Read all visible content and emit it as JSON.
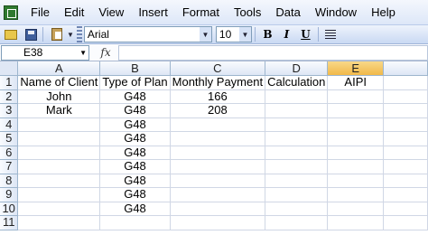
{
  "menu": {
    "items": [
      {
        "label": "File"
      },
      {
        "label": "Edit"
      },
      {
        "label": "View"
      },
      {
        "label": "Insert"
      },
      {
        "label": "Format"
      },
      {
        "label": "Tools"
      },
      {
        "label": "Data"
      },
      {
        "label": "Window"
      },
      {
        "label": "Help"
      }
    ]
  },
  "toolbar": {
    "font_name": "Arial",
    "font_size": "10",
    "bold_label": "B",
    "italic_label": "I",
    "underline_label": "U"
  },
  "formula_bar": {
    "name_box": "E38",
    "fx_label": "fx",
    "value": ""
  },
  "sheet": {
    "columns": [
      "A",
      "B",
      "C",
      "D",
      "E"
    ],
    "selected_column": "E",
    "rows": [
      {
        "num": "1",
        "cells": [
          "Name of Client",
          "Type of Plan",
          "Monthly Payment",
          "Calculation",
          "AIPI"
        ]
      },
      {
        "num": "2",
        "cells": [
          "John",
          "G48",
          "166",
          "",
          ""
        ]
      },
      {
        "num": "3",
        "cells": [
          "Mark",
          "G48",
          "208",
          "",
          ""
        ]
      },
      {
        "num": "4",
        "cells": [
          "",
          "G48",
          "",
          "",
          ""
        ]
      },
      {
        "num": "5",
        "cells": [
          "",
          "G48",
          "",
          "",
          ""
        ]
      },
      {
        "num": "6",
        "cells": [
          "",
          "G48",
          "",
          "",
          ""
        ]
      },
      {
        "num": "7",
        "cells": [
          "",
          "G48",
          "",
          "",
          ""
        ]
      },
      {
        "num": "8",
        "cells": [
          "",
          "G48",
          "",
          "",
          ""
        ]
      },
      {
        "num": "9",
        "cells": [
          "",
          "G48",
          "",
          "",
          ""
        ]
      },
      {
        "num": "10",
        "cells": [
          "",
          "G48",
          "",
          "",
          ""
        ]
      },
      {
        "num": "11",
        "cells": [
          "",
          "",
          "",
          "",
          ""
        ]
      }
    ]
  }
}
